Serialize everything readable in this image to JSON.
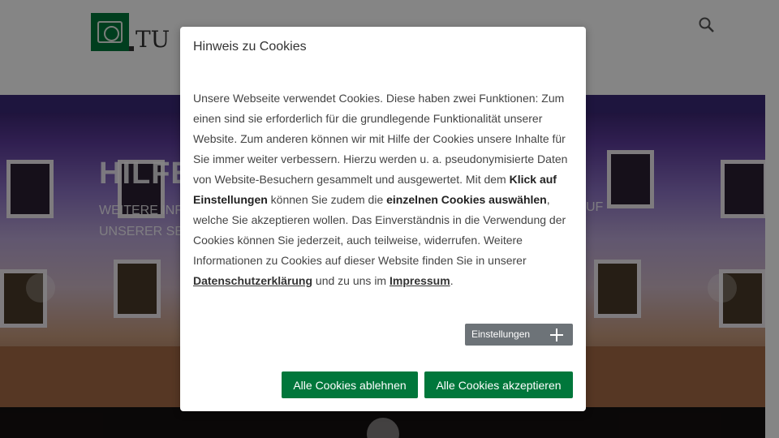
{
  "header": {
    "logo_text": "TU",
    "search_icon": "search-icon"
  },
  "hero": {
    "title": "HILFE",
    "subtitle_line1": "WEITERE INFO",
    "subtitle_line2": "UNSERER SEI",
    "subtitle_tail": "UF"
  },
  "cookie_modal": {
    "title": "Hinweis zu Cookies",
    "text_1": "Unsere Webseite verwendet Cookies. Diese haben zwei Funktionen: Zum einen sind sie erforderlich für die grundlegende Funktionalität unserer Website. Zum anderen können wir mit Hilfe der Cookies unsere Inhalte für Sie immer weiter verbessern. Hierzu werden u. a. pseudonymisierte Daten von Website-Besuchern gesammelt und ausgewertet. Mit dem ",
    "text_bold_1": "Klick auf Einstellungen",
    "text_2": " können Sie zudem die ",
    "text_bold_2": "einzelnen Cookies auswählen",
    "text_3": ", welche Sie akzeptieren wollen. Das Einverständnis in die Verwendung der Cookies können Sie jederzeit, auch teilweise, widerrufen. Weitere Informationen zu Cookies auf dieser Website finden Sie in unserer ",
    "privacy_link": "Datenschutzerklärung",
    "text_4": " und zu uns im ",
    "imprint_link": "Impressum",
    "text_5": ".",
    "settings_label": "Einstellungen",
    "reject_label": "Alle Cookies ablehnen",
    "accept_label": "Alle Cookies akzeptieren"
  },
  "colors": {
    "brand_green": "#00773b",
    "settings_gray": "#6d7378"
  }
}
